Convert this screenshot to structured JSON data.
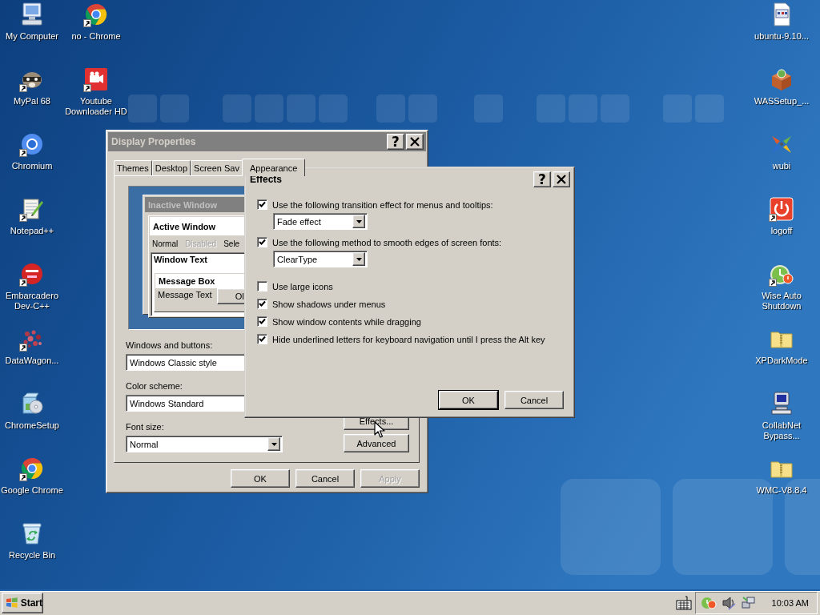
{
  "desktop": {
    "icon_columns": [
      [
        {
          "label": "My Computer",
          "kind": "computer",
          "shortcut": false
        },
        {
          "label": "MyPal 68",
          "kind": "animal",
          "shortcut": true
        },
        {
          "label": "Chromium",
          "kind": "chromium",
          "shortcut": true
        },
        {
          "label": "Notepad++",
          "kind": "notepad",
          "shortcut": true
        },
        {
          "label": "Embarcadero Dev-C++",
          "kind": "roundlogo",
          "shortcut": true
        },
        {
          "label": "DataWagon...",
          "kind": "dots",
          "shortcut": true
        },
        {
          "label": "ChromeSetup",
          "kind": "setup",
          "shortcut": false
        },
        {
          "label": "Google Chrome",
          "kind": "chrome",
          "shortcut": true
        },
        {
          "label": "Recycle Bin",
          "kind": "recycle",
          "shortcut": false
        }
      ],
      [
        {
          "label": "no - Chrome",
          "kind": "chrome",
          "shortcut": true
        },
        {
          "label": "Youtube Downloader HD",
          "kind": "camera",
          "shortcut": true
        }
      ]
    ],
    "right_icons": [
      {
        "label": "ubuntu-9.10...",
        "kind": "document",
        "shortcut": false
      },
      {
        "label": "WASSetup_...",
        "kind": "package",
        "shortcut": false
      },
      {
        "label": "wubi",
        "kind": "pinwheel",
        "shortcut": false
      },
      {
        "label": "logoff",
        "kind": "power",
        "shortcut": true
      },
      {
        "label": "Wise Auto Shutdown",
        "kind": "clock",
        "shortcut": true
      },
      {
        "label": "XPDarkMode",
        "kind": "zip",
        "shortcut": false
      },
      {
        "label": "CollabNet Bypass...",
        "kind": "monitor",
        "shortcut": false
      },
      {
        "label": "WMC-V8.8.4",
        "kind": "zip",
        "shortcut": false
      }
    ]
  },
  "display_properties": {
    "title": "Display Properties",
    "help_button": "?",
    "tabs": [
      {
        "label": "Themes",
        "selected": false
      },
      {
        "label": "Desktop",
        "selected": false
      },
      {
        "label": "Screen Sav",
        "selected": false
      },
      {
        "label": "Appearance",
        "selected": true
      }
    ],
    "preview": {
      "inactive_title": "Inactive Window",
      "active_title": "Active Window",
      "menu_items": [
        {
          "label": "Normal",
          "disabled": false
        },
        {
          "label": "Disabled",
          "disabled": true
        },
        {
          "label": "Sele",
          "disabled": false
        }
      ],
      "window_text": "Window Text",
      "message_box_title": "Message Box",
      "message_text": "Message Text",
      "message_button": "Ol"
    },
    "fields": [
      {
        "label": "Windows and buttons:",
        "value": "Windows Classic style"
      },
      {
        "label": "Color scheme:",
        "value": "Windows Standard"
      },
      {
        "label": "Font size:",
        "value": "Normal"
      }
    ],
    "side_buttons": [
      "Effects...",
      "Advanced"
    ],
    "buttons": [
      {
        "label": "OK",
        "disabled": false
      },
      {
        "label": "Cancel",
        "disabled": false
      },
      {
        "label": "Apply",
        "disabled": true
      }
    ]
  },
  "effects_dialog": {
    "title": "Effects",
    "help_button": "?",
    "options": [
      {
        "label": "Use the following transition effect for menus and tooltips:",
        "checked": true,
        "dropdown": "Fade effect"
      },
      {
        "label": "Use the following method to smooth edges of screen fonts:",
        "checked": true,
        "dropdown": "ClearType"
      },
      {
        "label": "Use large icons",
        "checked": false
      },
      {
        "label": "Show shadows under menus",
        "checked": true
      },
      {
        "label": "Show window contents while dragging",
        "checked": true
      },
      {
        "label": "Hide underlined letters for keyboard navigation until I press the Alt key",
        "checked": true
      }
    ],
    "buttons": [
      {
        "label": "OK",
        "default": true
      },
      {
        "label": "Cancel",
        "default": false
      }
    ]
  },
  "taskbar": {
    "start": "Start",
    "clock": "10:03 AM"
  }
}
